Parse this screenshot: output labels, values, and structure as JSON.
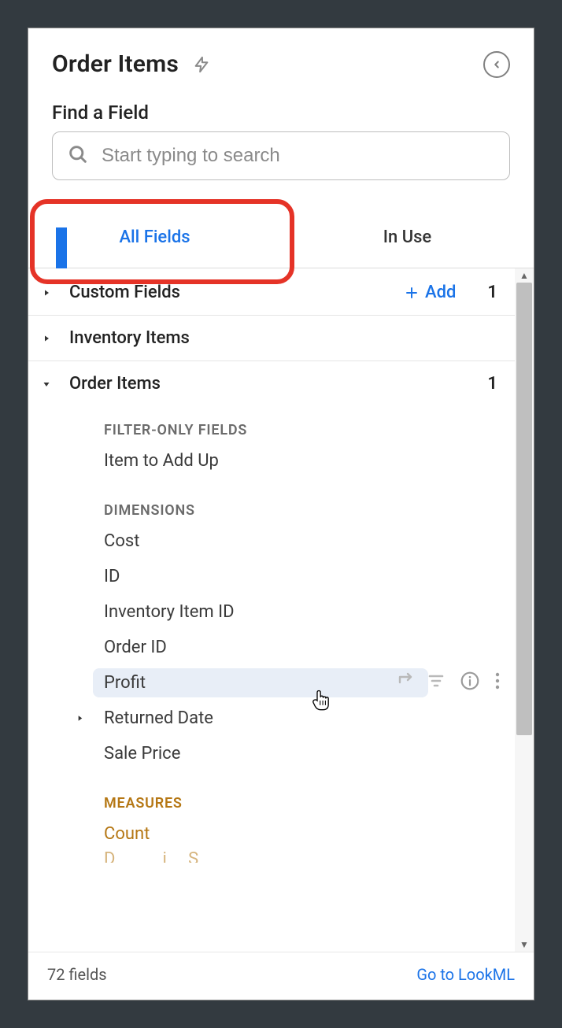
{
  "header": {
    "title": "Order Items"
  },
  "search": {
    "label": "Find a Field",
    "placeholder": "Start typing to search"
  },
  "tabs": {
    "all": "All Fields",
    "in_use": "In Use"
  },
  "groups": {
    "custom": {
      "title": "Custom Fields",
      "add": "Add",
      "count": "1"
    },
    "inventory": {
      "title": "Inventory Items"
    },
    "order_items": {
      "title": "Order Items",
      "count": "1"
    }
  },
  "sections": {
    "filter_only": "FILTER-ONLY FIELDS",
    "dimensions": "DIMENSIONS",
    "measures": "MEASURES"
  },
  "fields": {
    "item_to_add_up": "Item to Add Up",
    "cost": "Cost",
    "id": "ID",
    "inventory_item_id": "Inventory Item ID",
    "order_id": "Order ID",
    "profit": "Profit",
    "returned_date": "Returned Date",
    "sale_price": "Sale Price",
    "count": "Count",
    "dynamic_sum_partial": "Dynamic Sum"
  },
  "footer": {
    "count": "72 fields",
    "link": "Go to LookML"
  }
}
